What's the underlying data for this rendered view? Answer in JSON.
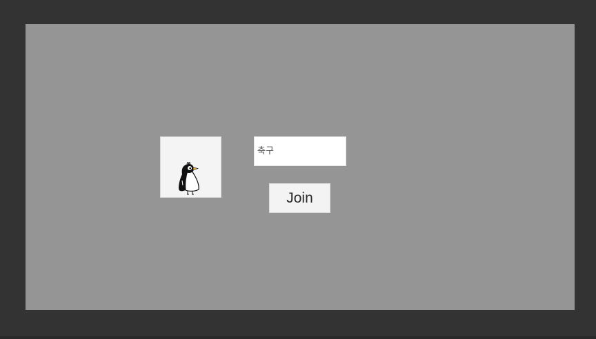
{
  "colors": {
    "window_frame": "#333333",
    "viewport_background": "#959595",
    "panel_background": "#f4f4f4",
    "input_background": "#ffffff",
    "button_background": "#f3f3f3",
    "button_text": "#2a2a2a",
    "penguin_beak": "#e8a93a"
  },
  "avatar": {
    "icon": "penguin-icon"
  },
  "name_input": {
    "value": "",
    "placeholder": "축구"
  },
  "join_button": {
    "label": "Join"
  }
}
